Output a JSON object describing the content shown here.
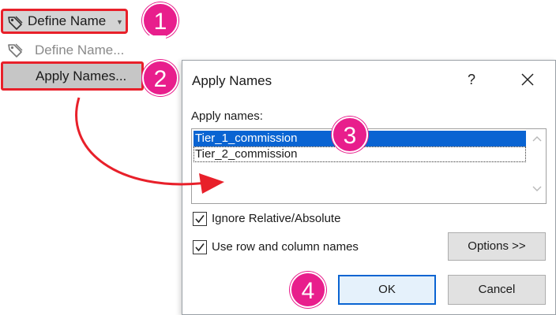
{
  "ribbon": {
    "define_name_label": "Define Name",
    "define_name_icon": "tag-icon",
    "dropdown_icon": "caret-down-icon"
  },
  "menu": {
    "items": [
      {
        "label": "Define Name...",
        "icon": "tag-icon",
        "enabled": false
      },
      {
        "label": "Apply Names...",
        "enabled": true,
        "highlighted": true
      }
    ]
  },
  "badges": [
    "1",
    "2",
    "3",
    "4"
  ],
  "dialog": {
    "title": "Apply Names",
    "help": "?",
    "close_icon": "close-icon",
    "apply_names_label": "Apply names:",
    "names": [
      {
        "label": "Tier_1_commission",
        "selected": true
      },
      {
        "label": "Tier_2_commission",
        "selected": false
      }
    ],
    "checkboxes": [
      {
        "label": "Ignore Relative/Absolute",
        "checked": true
      },
      {
        "label": "Use row and column names",
        "checked": true
      }
    ],
    "options_label": "Options >>",
    "ok_label": "OK",
    "cancel_label": "Cancel"
  },
  "colors": {
    "highlight_border": "#e8202a",
    "badge": "#e81e8c",
    "selection": "#0a64d2",
    "arrow": "#e8202a"
  }
}
